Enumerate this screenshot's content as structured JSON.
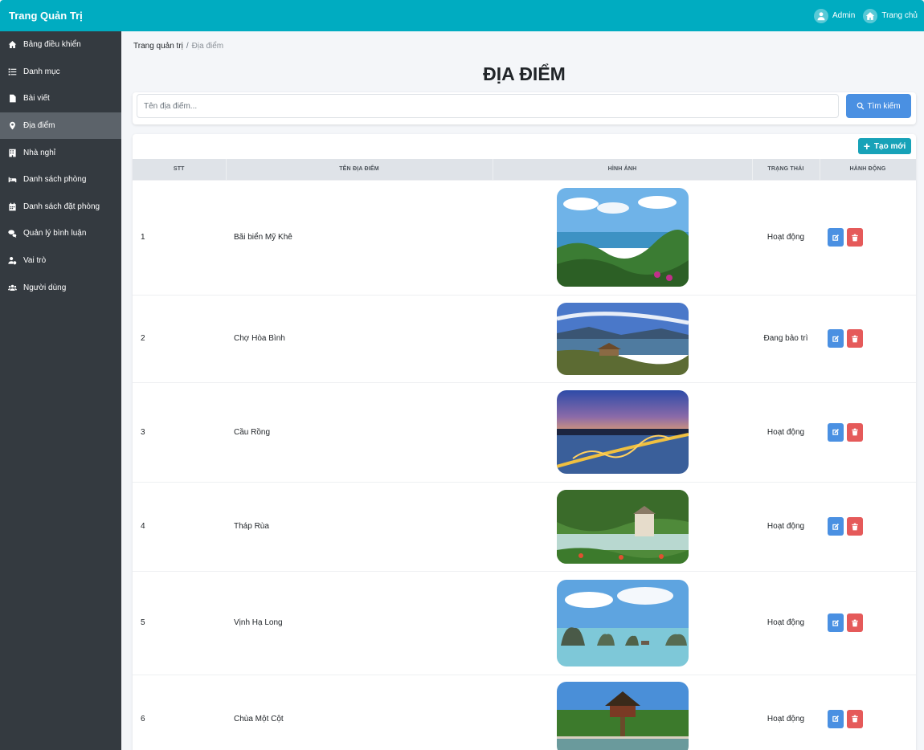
{
  "app": {
    "brand": "Trang Quản Trị",
    "top_links": [
      {
        "label": "Admin",
        "icon": "user-circle-icon"
      },
      {
        "label": "Trang chủ",
        "icon": "home-icon"
      }
    ]
  },
  "sidebar": {
    "items": [
      {
        "label": "Bảng điều khiển",
        "icon": "home-icon",
        "active": false
      },
      {
        "label": "Danh mục",
        "icon": "list-icon",
        "active": false
      },
      {
        "label": "Bài viết",
        "icon": "file-icon",
        "active": false
      },
      {
        "label": "Địa điểm",
        "icon": "map-pin-icon",
        "active": true
      },
      {
        "label": "Nhà nghỉ",
        "icon": "building-icon",
        "active": false
      },
      {
        "label": "Danh sách phòng",
        "icon": "bed-icon",
        "active": false
      },
      {
        "label": "Danh sách đặt phòng",
        "icon": "calendar-icon",
        "active": false
      },
      {
        "label": "Quản lý bình luận",
        "icon": "comments-icon",
        "active": false
      },
      {
        "label": "Vai trò",
        "icon": "user-cog-icon",
        "active": false
      },
      {
        "label": "Người dùng",
        "icon": "users-icon",
        "active": false
      }
    ]
  },
  "breadcrumb": {
    "root": "Trang quản trị",
    "separator": "/",
    "current": "Địa điểm"
  },
  "page": {
    "title": "ĐỊA ĐIỂM"
  },
  "search": {
    "placeholder": "Tên địa điểm...",
    "value": "",
    "button_label": "Tìm kiếm"
  },
  "toolbar": {
    "create_label": "Tạo mới"
  },
  "table": {
    "columns": [
      "STT",
      "TÊN ĐỊA ĐIỂM",
      "HÌNH ẢNH",
      "TRẠNG THÁI",
      "HÀNH ĐỘNG"
    ],
    "rows": [
      {
        "stt": "1",
        "name": "Bãi biển Mỹ Khê",
        "image": "beach-landscape",
        "status": "Hoạt động"
      },
      {
        "stt": "2",
        "name": "Chợ Hòa Bình",
        "image": "lake-village-landscape",
        "status": "Đang bảo trì"
      },
      {
        "stt": "3",
        "name": "Cầu Rồng",
        "image": "dragon-bridge-night",
        "status": "Hoạt động"
      },
      {
        "stt": "4",
        "name": "Tháp Rùa",
        "image": "turtle-tower-lake",
        "status": "Hoạt động"
      },
      {
        "stt": "5",
        "name": "Vịnh Hạ Long",
        "image": "halong-bay-islands",
        "status": "Hoạt động"
      },
      {
        "stt": "6",
        "name": "Chùa Một Cột",
        "image": "one-pillar-pagoda",
        "status": "Hoạt động"
      }
    ]
  },
  "colors": {
    "topbar": "#00acc1",
    "sidebar": "#343a40",
    "sidebar_active": "#5c636a",
    "primary": "#4a90e2",
    "danger": "#e55a5a",
    "info": "#17a2b8"
  }
}
